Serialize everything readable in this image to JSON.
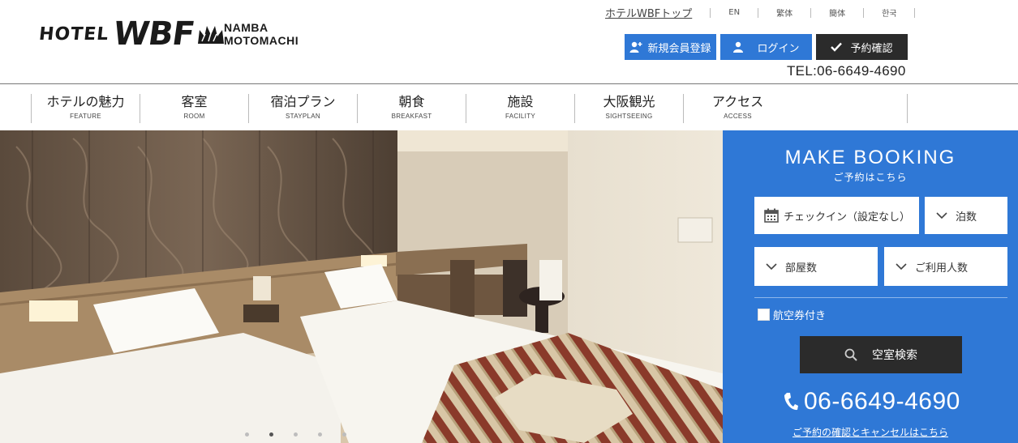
{
  "logo": {
    "hotel": "HOTEL",
    "brand": "WBF",
    "area_line1": "NAMBA",
    "area_line2": "MOTOMACHI"
  },
  "toplinks": {
    "home": "ホテルWBFトップ",
    "langs": [
      "EN",
      "繁体",
      "簡体",
      "한국"
    ]
  },
  "buttons": {
    "register": "新規会員登録",
    "login": "ログイン",
    "confirm": "予約確認"
  },
  "tel_top": "TEL:06-6649-4690",
  "nav": [
    {
      "jp": "ホテルの魅力",
      "en": "FEATURE"
    },
    {
      "jp": "客室",
      "en": "ROOM"
    },
    {
      "jp": "宿泊プラン",
      "en": "STAYPLAN"
    },
    {
      "jp": "朝食",
      "en": "BREAKFAST"
    },
    {
      "jp": "施設",
      "en": "FACILITY"
    },
    {
      "jp": "大阪観光",
      "en": "SIGHTSEEING"
    },
    {
      "jp": "アクセス",
      "en": "ACCESS"
    }
  ],
  "slider": {
    "count": 5,
    "active": 2
  },
  "booking": {
    "title": "MAKE BOOKING",
    "subtitle": "ご予約はこちら",
    "checkin": "チェックイン（設定なし）",
    "nights": "泊数",
    "rooms": "部屋数",
    "guests": "ご利用人数",
    "flight": "航空券付き",
    "search": "空室検索",
    "tel": "06-6649-4690",
    "cancel": "ご予約の確認とキャンセルはこちら"
  },
  "colors": {
    "accent": "#2f78d6",
    "dark": "#2b2b2b"
  }
}
